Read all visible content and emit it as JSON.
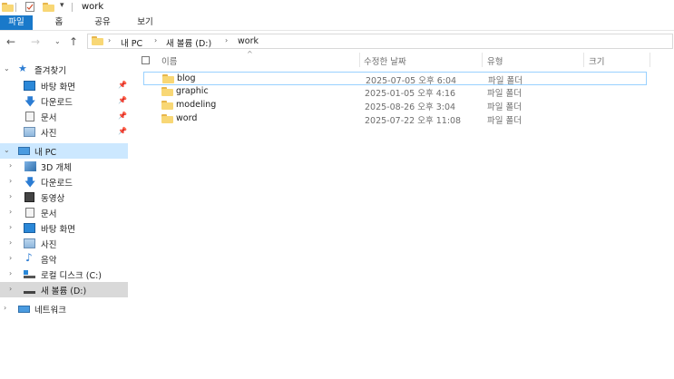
{
  "window": {
    "title": "work"
  },
  "ribbon": {
    "tabs": [
      {
        "label": "파일",
        "active": true
      },
      {
        "label": "홈"
      },
      {
        "label": "공유"
      },
      {
        "label": "보기"
      }
    ]
  },
  "address": {
    "crumbs": [
      "내 PC",
      "새 볼륨 (D:)",
      "work"
    ]
  },
  "nav": {
    "quick_access": {
      "label": "즐겨찾기",
      "items": [
        {
          "label": "바탕 화면",
          "icon": "desktop-icon"
        },
        {
          "label": "다운로드",
          "icon": "download-icon"
        },
        {
          "label": "문서",
          "icon": "documents-icon"
        },
        {
          "label": "사진",
          "icon": "pictures-icon"
        }
      ]
    },
    "this_pc": {
      "label": "내 PC",
      "items": [
        {
          "label": "3D 개체",
          "icon": "3d-objects-icon"
        },
        {
          "label": "다운로드",
          "icon": "download-icon"
        },
        {
          "label": "동영상",
          "icon": "videos-icon"
        },
        {
          "label": "문서",
          "icon": "documents-icon"
        },
        {
          "label": "바탕 화면",
          "icon": "desktop-icon"
        },
        {
          "label": "사진",
          "icon": "pictures-icon"
        },
        {
          "label": "음악",
          "icon": "music-icon"
        },
        {
          "label": "로컬 디스크 (C:)",
          "icon": "local-disk-icon"
        },
        {
          "label": "새 볼륨 (D:)",
          "icon": "volume-icon"
        }
      ]
    },
    "network": {
      "label": "네트워크"
    }
  },
  "list": {
    "columns": {
      "name": "이름",
      "date": "수정한 날짜",
      "type": "유형",
      "size": "크기"
    },
    "rows": [
      {
        "name": "blog",
        "date": "2025-07-05 오후 6:04",
        "type": "파일 폴더"
      },
      {
        "name": "graphic",
        "date": "2025-01-05 오후 4:16",
        "type": "파일 폴더"
      },
      {
        "name": "modeling",
        "date": "2025-08-26 오후 3:04",
        "type": "파일 폴더"
      },
      {
        "name": "word",
        "date": "2025-07-22 오후 11:08",
        "type": "파일 폴더"
      }
    ]
  }
}
